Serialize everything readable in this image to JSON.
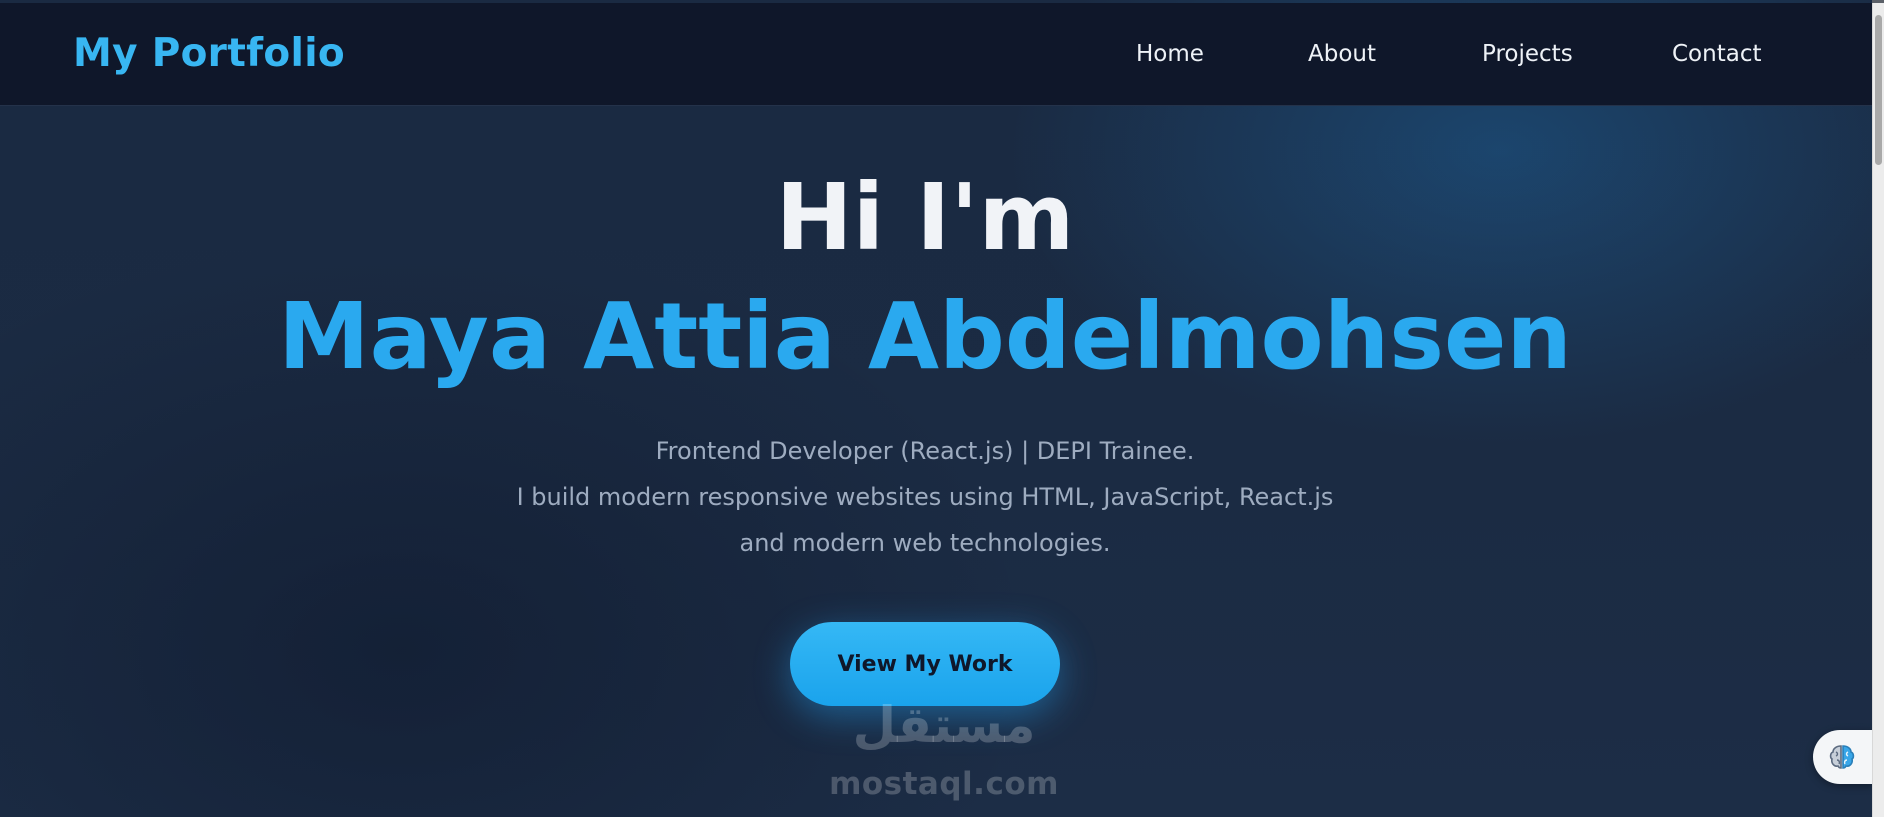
{
  "navbar": {
    "logo": "My Portfolio",
    "links": [
      {
        "label": "Home"
      },
      {
        "label": "About"
      },
      {
        "label": "Projects"
      },
      {
        "label": "Contact"
      }
    ]
  },
  "hero": {
    "greeting": "Hi I'm",
    "name": "Maya Attia Abdelmohsen",
    "description_lines": [
      "Frontend Developer (React.js) | DEPI Trainee.",
      "I build modern responsive websites using HTML, JavaScript, React.js",
      "and modern web technologies."
    ],
    "cta_label": "View My Work"
  },
  "watermark": {
    "arabic": "مستقل",
    "latin": "mostaql.com"
  },
  "widget": {
    "icon": "brain-icon"
  },
  "colors": {
    "accent": "#2aa9ef",
    "navbar_bg": "#0f172a",
    "hero_bg": "#1b2b43",
    "heading": "#f1f3f7",
    "muted_text": "#9eacc0"
  }
}
